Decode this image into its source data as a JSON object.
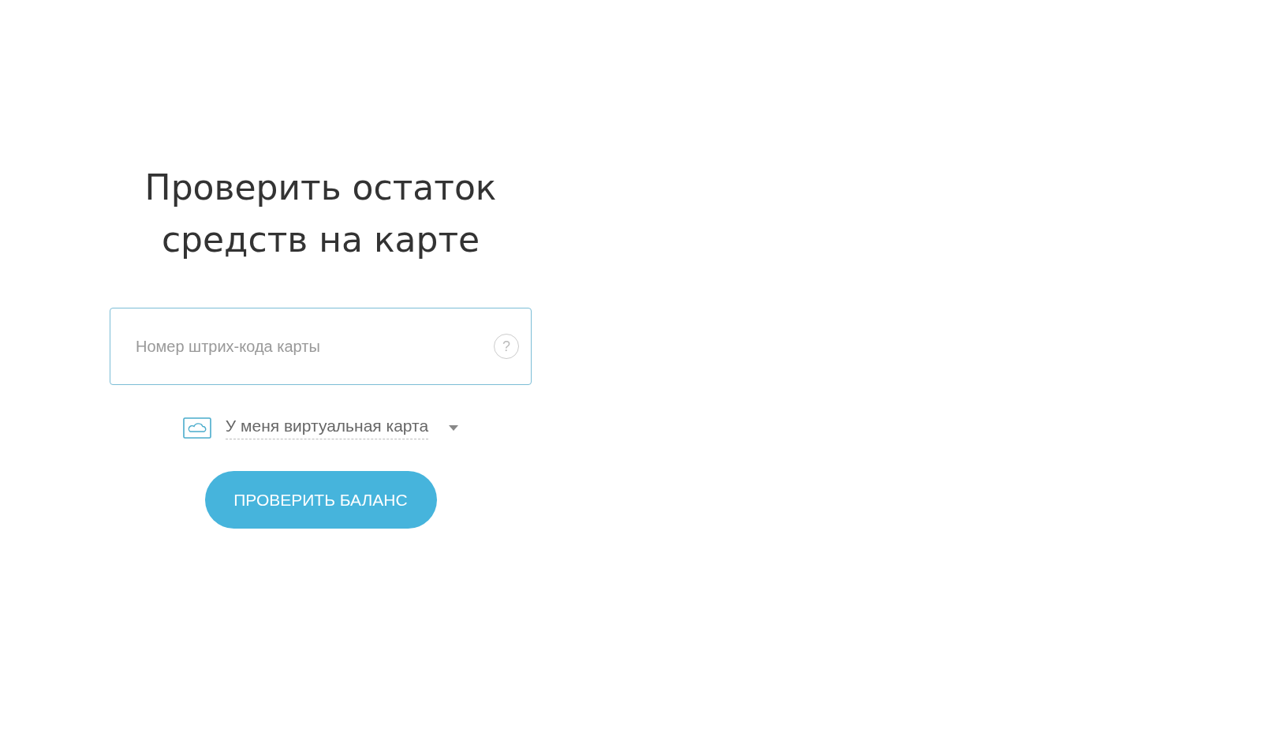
{
  "title_lines": [
    "Проверить остаток",
    "средств на карте"
  ],
  "barcode_field": {
    "placeholder": "Номер штрих-кода карты",
    "help": "?"
  },
  "card_type": {
    "label": "У меня виртуальная карта"
  },
  "submit_button": {
    "label": "ПРОВЕРИТЬ БАЛАНС"
  }
}
